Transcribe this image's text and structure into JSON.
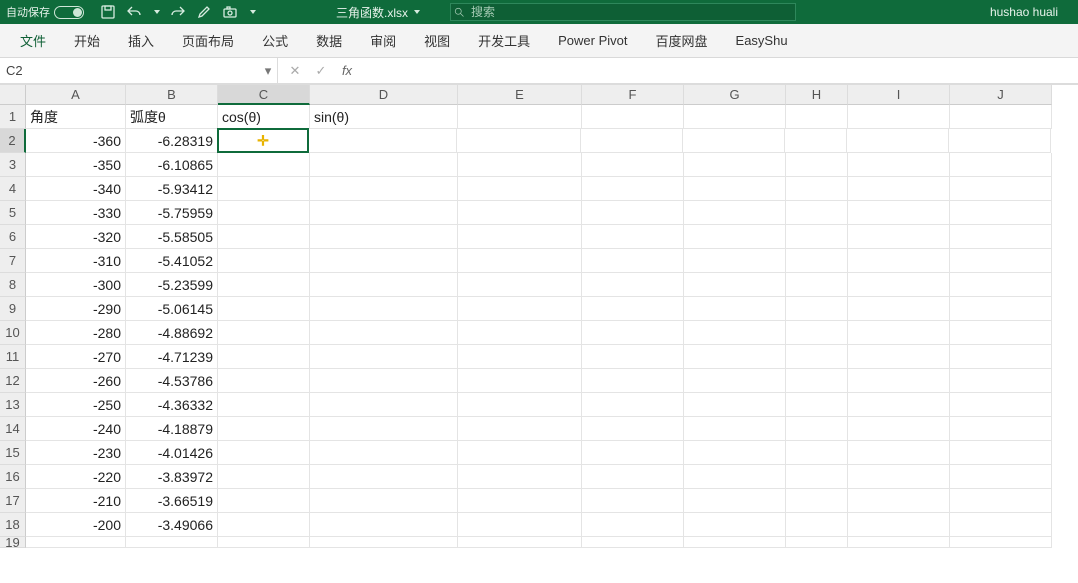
{
  "titleBar": {
    "autosave_label": "自动保存",
    "filename": "三角函数.xlsx",
    "search_placeholder": "搜索",
    "username": "hushao huali"
  },
  "ribbon": {
    "tabs": [
      "文件",
      "开始",
      "插入",
      "页面布局",
      "公式",
      "数据",
      "审阅",
      "视图",
      "开发工具",
      "Power Pivot",
      "百度网盘",
      "EasyShu"
    ]
  },
  "formulaBar": {
    "name_box": "C2",
    "formula": ""
  },
  "sheet": {
    "columns": [
      "A",
      "B",
      "C",
      "D",
      "E",
      "F",
      "G",
      "H",
      "I",
      "J"
    ],
    "row_header_start": 1,
    "row_header_end": 19,
    "headers": {
      "A": "角度",
      "B": "弧度θ",
      "C": "cos(θ)",
      "D": "sin(θ)"
    },
    "data": [
      {
        "A": "-360",
        "B": "-6.28319"
      },
      {
        "A": "-350",
        "B": "-6.10865"
      },
      {
        "A": "-340",
        "B": "-5.93412"
      },
      {
        "A": "-330",
        "B": "-5.75959"
      },
      {
        "A": "-320",
        "B": "-5.58505"
      },
      {
        "A": "-310",
        "B": "-5.41052"
      },
      {
        "A": "-300",
        "B": "-5.23599"
      },
      {
        "A": "-290",
        "B": "-5.06145"
      },
      {
        "A": "-280",
        "B": "-4.88692"
      },
      {
        "A": "-270",
        "B": "-4.71239"
      },
      {
        "A": "-260",
        "B": "-4.53786"
      },
      {
        "A": "-250",
        "B": "-4.36332"
      },
      {
        "A": "-240",
        "B": "-4.18879"
      },
      {
        "A": "-230",
        "B": "-4.01426"
      },
      {
        "A": "-220",
        "B": "-3.83972"
      },
      {
        "A": "-210",
        "B": "-3.66519"
      },
      {
        "A": "-200",
        "B": "-3.49066"
      }
    ],
    "active_cell": "C2"
  }
}
